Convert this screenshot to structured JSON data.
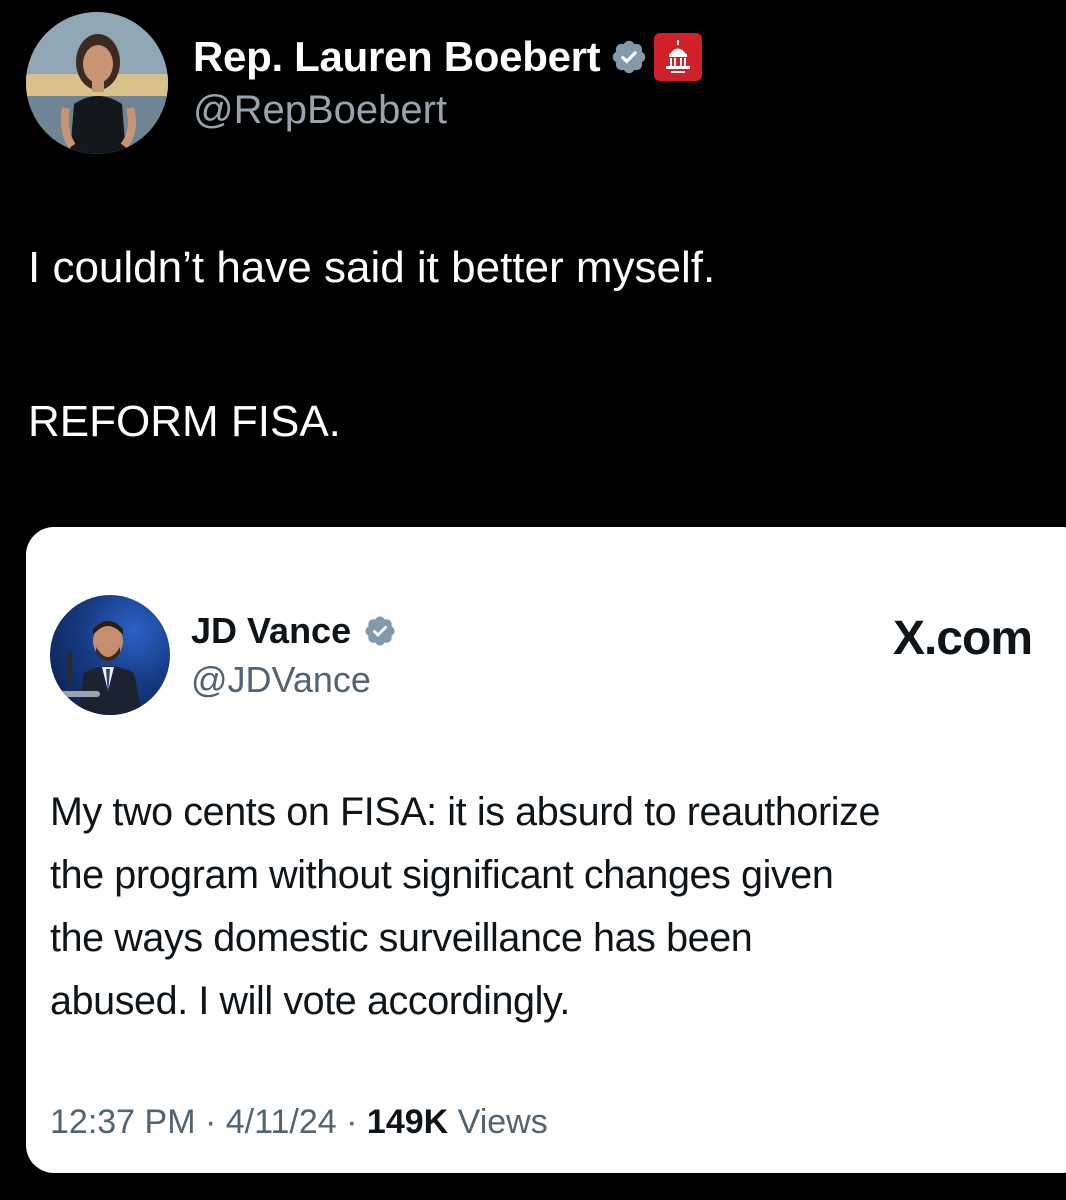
{
  "author": {
    "name": "Rep. Lauren Boebert",
    "handle": "@RepBoebert",
    "verified_color": "#829aab",
    "badge_color": "#d0202a"
  },
  "tweet": {
    "line1": "I couldn’t have said it better myself.",
    "line2": "REFORM FISA."
  },
  "quoted": {
    "name": "JD Vance",
    "handle": "@JDVance",
    "source_label": "X.com",
    "verified_color": "#829aab",
    "body_lines": [
      "My two cents on FISA: it is absurd to reauthorize",
      "the program without significant changes given",
      "the ways domestic surveillance has been",
      "abused. I will vote accordingly."
    ],
    "time": "12:37 PM",
    "date": "4/11/24",
    "views_count": "149K",
    "views_label": "Views",
    "separator": "·"
  }
}
